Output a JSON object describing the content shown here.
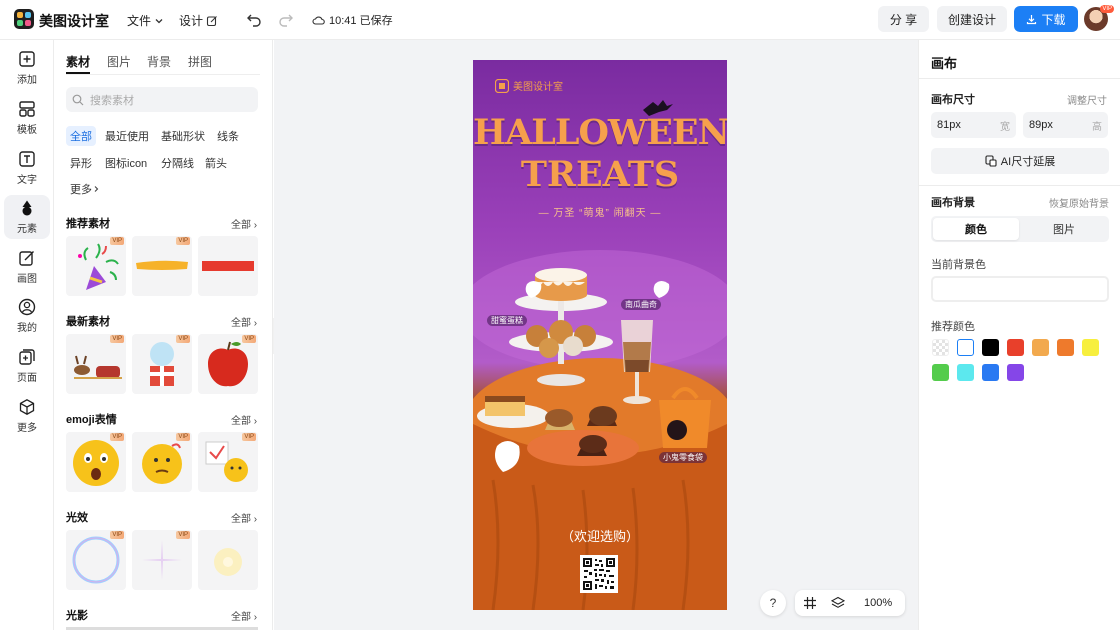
{
  "app": {
    "brand": "美图设计室"
  },
  "toolbar": {
    "file_label": "文件",
    "design_label": "设计",
    "saved_status": "10:41 已保存",
    "share_label": "分 享",
    "create_label": "创建设计",
    "download_label": "下载",
    "avatar_badge": "VIP"
  },
  "nav": [
    {
      "label": "添加",
      "icon": "plus-square-icon"
    },
    {
      "label": "模板",
      "icon": "template-icon"
    },
    {
      "label": "文字",
      "icon": "text-icon"
    },
    {
      "label": "元素",
      "icon": "shapes-icon"
    },
    {
      "label": "画图",
      "icon": "draw-icon"
    },
    {
      "label": "我的",
      "icon": "user-icon"
    },
    {
      "label": "页面",
      "icon": "page-icon"
    },
    {
      "label": "更多",
      "icon": "cube-icon"
    }
  ],
  "panel": {
    "tabs": [
      "素材",
      "图片",
      "背景",
      "拼图"
    ],
    "search_placeholder": "搜索素材",
    "chips": [
      "全部",
      "最近使用",
      "基础形状",
      "线条",
      "异形",
      "图标icon",
      "分隔线",
      "箭头",
      "更多"
    ],
    "vip": "VIP",
    "sections": [
      {
        "title": "推荐素材",
        "all": "全部"
      },
      {
        "title": "最新素材",
        "all": "全部"
      },
      {
        "title": "emoji表情",
        "all": "全部"
      },
      {
        "title": "光效",
        "all": "全部"
      },
      {
        "title": "光影",
        "all": "全部"
      }
    ]
  },
  "poster": {
    "brand": "美图设计室",
    "title_line1": "HALLOWEEN",
    "title_line2": "TREATS",
    "subtitle": "— 万圣 “萌鬼” 闹翻天 —",
    "label_1": "甜蜜蛋糕",
    "label_2": "南瓜曲奇",
    "label_3": "小鬼零食袋",
    "welcome": "（欢迎选购）"
  },
  "zoom": {
    "level": "100%",
    "help": "?"
  },
  "right": {
    "title": "画布",
    "size_label": "画布尺寸",
    "size_link": "调整尺寸",
    "width_value": "81px",
    "width_unit": "宽",
    "height_value": "89px",
    "height_unit": "高",
    "ai_label": "AI尺寸延展",
    "bg_label": "画布背景",
    "bg_link": "恢复原始背景",
    "tab_color": "颜色",
    "tab_image": "图片",
    "current_label": "当前背景色",
    "recommend_label": "推荐颜色",
    "swatches": [
      "transparent",
      "#ffffff",
      "#000000",
      "#e8402b",
      "#f2a94e",
      "#ee7a2c",
      "#f7ef3e",
      "#54cc4c",
      "#5ce8ee",
      "#2979f2",
      "#8546e8"
    ]
  }
}
